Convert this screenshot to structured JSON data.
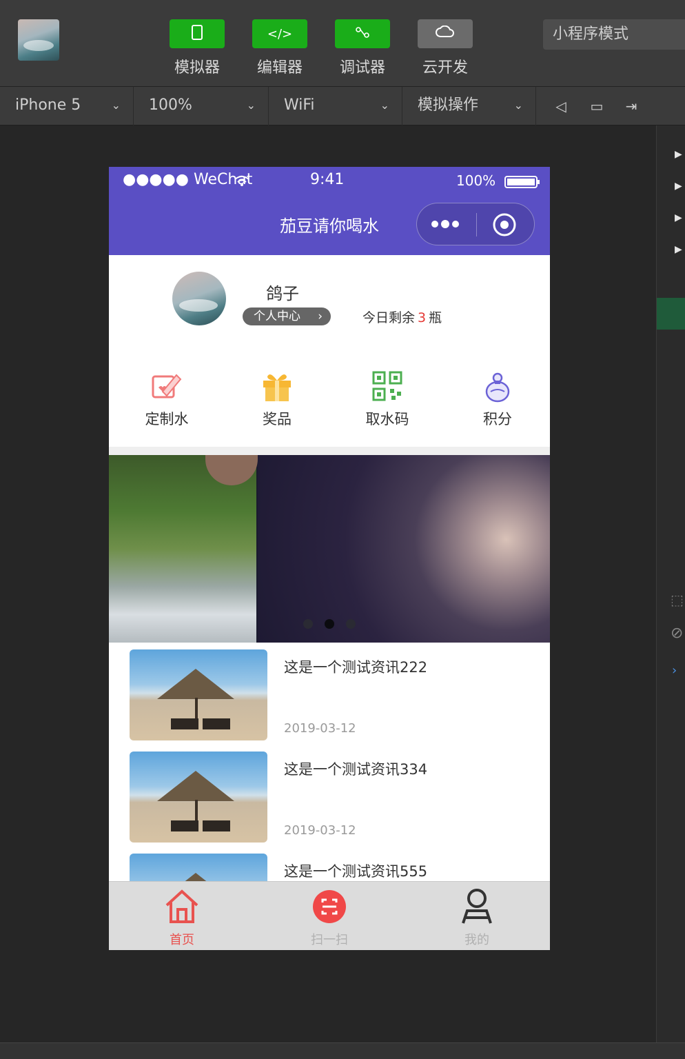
{
  "ide": {
    "tools": [
      {
        "label": "模拟器",
        "icon": "phone-icon"
      },
      {
        "label": "编辑器",
        "icon": "code-icon"
      },
      {
        "label": "调试器",
        "icon": "debugger-icon"
      },
      {
        "label": "云开发",
        "icon": "cloud-icon"
      }
    ],
    "mode": "小程序模式",
    "device": "iPhone 5",
    "zoom": "100%",
    "network": "WiFi",
    "simulate": "模拟操作"
  },
  "phone": {
    "status": {
      "carrier": "●●●●● WeChat",
      "time": "9:41",
      "battery": "100%"
    },
    "nav_title": "茄豆请你喝水",
    "profile": {
      "name": "鸽子",
      "center": "个人中心",
      "remain_prefix": "今日剩余",
      "remain_count": "3",
      "remain_suffix": "瓶"
    },
    "menu": [
      {
        "label": "定制水",
        "icon": "custom-water-icon"
      },
      {
        "label": "奖品",
        "icon": "gift-icon"
      },
      {
        "label": "取水码",
        "icon": "qrcode-icon"
      },
      {
        "label": "积分",
        "icon": "points-icon"
      }
    ],
    "banner": {
      "slides": 3,
      "active": 2
    },
    "news": [
      {
        "title": "这是一个测试资讯222",
        "date": "2019-03-12"
      },
      {
        "title": "这是一个测试资讯334",
        "date": "2019-03-12"
      },
      {
        "title": "这是一个测试资讯555",
        "date": ""
      }
    ],
    "tabs": [
      {
        "label": "首页",
        "icon": "home-icon",
        "active": true
      },
      {
        "label": "扫一扫",
        "icon": "scan-icon",
        "active": false
      },
      {
        "label": "我的",
        "icon": "user-icon",
        "active": false
      }
    ],
    "colors": {
      "theme": "#5a4fc4",
      "accent": "#e8524f",
      "green": "#1aad19"
    }
  }
}
